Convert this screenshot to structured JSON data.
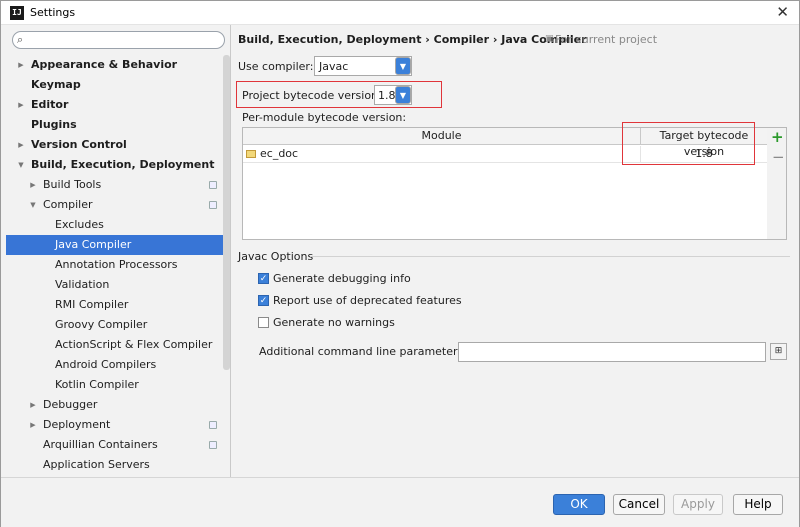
{
  "window": {
    "title": "Settings"
  },
  "search": {
    "placeholder": ""
  },
  "sidebar": {
    "items": [
      {
        "label": "Appearance & Behavior",
        "bold": true,
        "arrow": "right"
      },
      {
        "label": "Keymap",
        "bold": true
      },
      {
        "label": "Editor",
        "bold": true,
        "arrow": "right"
      },
      {
        "label": "Plugins",
        "bold": true
      },
      {
        "label": "Version Control",
        "bold": true,
        "arrow": "right"
      },
      {
        "label": "Build, Execution, Deployment",
        "bold": true,
        "arrow": "down"
      },
      {
        "label": "Build Tools",
        "arrow": "right",
        "project_icon": true
      },
      {
        "label": "Compiler",
        "arrow": "down",
        "project_icon": true
      },
      {
        "label": "Excludes"
      },
      {
        "label": "Java Compiler",
        "selected": true
      },
      {
        "label": "Annotation Processors"
      },
      {
        "label": "Validation"
      },
      {
        "label": "RMI Compiler"
      },
      {
        "label": "Groovy Compiler"
      },
      {
        "label": "ActionScript & Flex Compiler"
      },
      {
        "label": "Android Compilers"
      },
      {
        "label": "Kotlin Compiler"
      },
      {
        "label": "Debugger",
        "arrow": "right"
      },
      {
        "label": "Deployment",
        "arrow": "right",
        "project_icon": true
      },
      {
        "label": "Arquillian Containers",
        "project_icon": true
      },
      {
        "label": "Application Servers"
      }
    ]
  },
  "main": {
    "breadcrumb": "Build, Execution, Deployment › Compiler › Java Compiler",
    "scope_label": "For current project",
    "use_compiler": {
      "label": "Use compiler:",
      "value": "Javac"
    },
    "bytecode": {
      "label": "Project bytecode version:",
      "value": "1.8"
    },
    "per_module_label": "Per-module bytecode version:",
    "table": {
      "columns": [
        "Module",
        "Target bytecode version"
      ],
      "rows": [
        {
          "module": "ec_doc",
          "target": "1.8"
        }
      ]
    },
    "javac_options": {
      "title": "Javac Options",
      "generate_debug": {
        "label": "Generate debugging info",
        "checked": true
      },
      "report_deprecated": {
        "label": "Report use of deprecated features",
        "checked": true
      },
      "no_warnings": {
        "label": "Generate no warnings",
        "checked": false
      },
      "params_label": "Additional command line parameters:",
      "params_value": ""
    }
  },
  "buttons": {
    "ok": "OK",
    "cancel": "Cancel",
    "apply": "Apply",
    "help": "Help"
  },
  "colors": {
    "accent": "#3b80d9",
    "selection": "#3875d6",
    "highlight_box": "#e0353a"
  }
}
